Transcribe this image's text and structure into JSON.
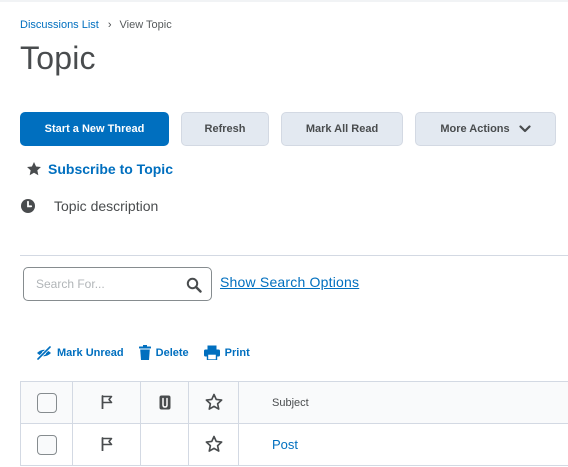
{
  "breadcrumb": {
    "parent": "Discussions List",
    "separator": "›",
    "current": "View Topic"
  },
  "page": {
    "title": "Topic"
  },
  "actions": {
    "start_thread": "Start a New Thread",
    "refresh": "Refresh",
    "mark_all_read": "Mark All Read",
    "more_actions": "More Actions"
  },
  "subscribe": {
    "label": "Subscribe to Topic",
    "icon": "star-filled-icon"
  },
  "topic": {
    "description": "Topic description",
    "icon": "clock-icon"
  },
  "search": {
    "placeholder": "Search For...",
    "value": "",
    "options_link": "Show Search Options"
  },
  "toolbar": {
    "mark_unread": "Mark Unread",
    "delete": "Delete",
    "print": "Print"
  },
  "table": {
    "columns": {
      "flag": "flag-icon",
      "attachment": "attachment-icon",
      "rating": "star-outline-icon",
      "subject": "Subject"
    },
    "rows": [
      {
        "subject": "Post",
        "checked": false
      }
    ]
  },
  "colors": {
    "accent": "#006fbf",
    "text": "#494c4e",
    "secondary_button": "#e3e9f1",
    "border": "#d3d9e3"
  }
}
